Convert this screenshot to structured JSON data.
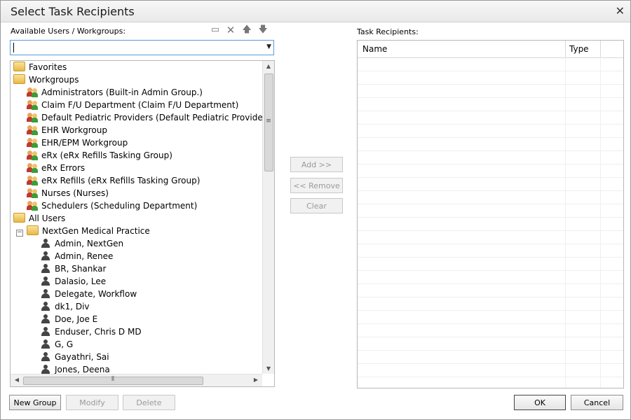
{
  "dialog": {
    "title": "Select Task Recipients"
  },
  "left": {
    "label": "Available Users / Workgroups:",
    "toolbar_icons": [
      "new-group-icon",
      "delete-x-icon",
      "move-up-icon",
      "move-down-icon"
    ],
    "combo_value": ""
  },
  "tree": {
    "favorites": "Favorites",
    "workgroups": "Workgroups",
    "groups": [
      "Administrators (Built-in Admin Group.)",
      "Claim F/U Department (Claim F/U Department)",
      "Default Pediatric Providers (Default Pediatric Providers for N",
      "EHR Workgroup",
      "EHR/EPM Workgroup",
      "eRx (eRx Refills Tasking Group)",
      "eRx Errors",
      "eRx Refills (eRx Refills Tasking Group)",
      "Nurses (Nurses)",
      "Schedulers (Scheduling Department)"
    ],
    "all_users": "All Users",
    "practice": "NextGen Medical Practice",
    "users": [
      "Admin, NextGen",
      "Admin, Renee",
      "BR, Shankar",
      "Dalasio, Lee",
      "Delegate, Workflow",
      "dk1, Div",
      "Doe, Joe E",
      "Enduser, Chris D MD",
      "G, G",
      "Gayathri, Sai",
      "Jones, Deena"
    ]
  },
  "middle": {
    "add": "Add >>",
    "remove": "<< Remove",
    "clear": "Clear"
  },
  "right": {
    "label": "Task Recipients:",
    "columns": [
      "Name",
      "Type"
    ]
  },
  "footer": {
    "new_group": "New Group",
    "modify": "Modify",
    "delete": "Delete",
    "ok": "OK",
    "cancel": "Cancel"
  }
}
